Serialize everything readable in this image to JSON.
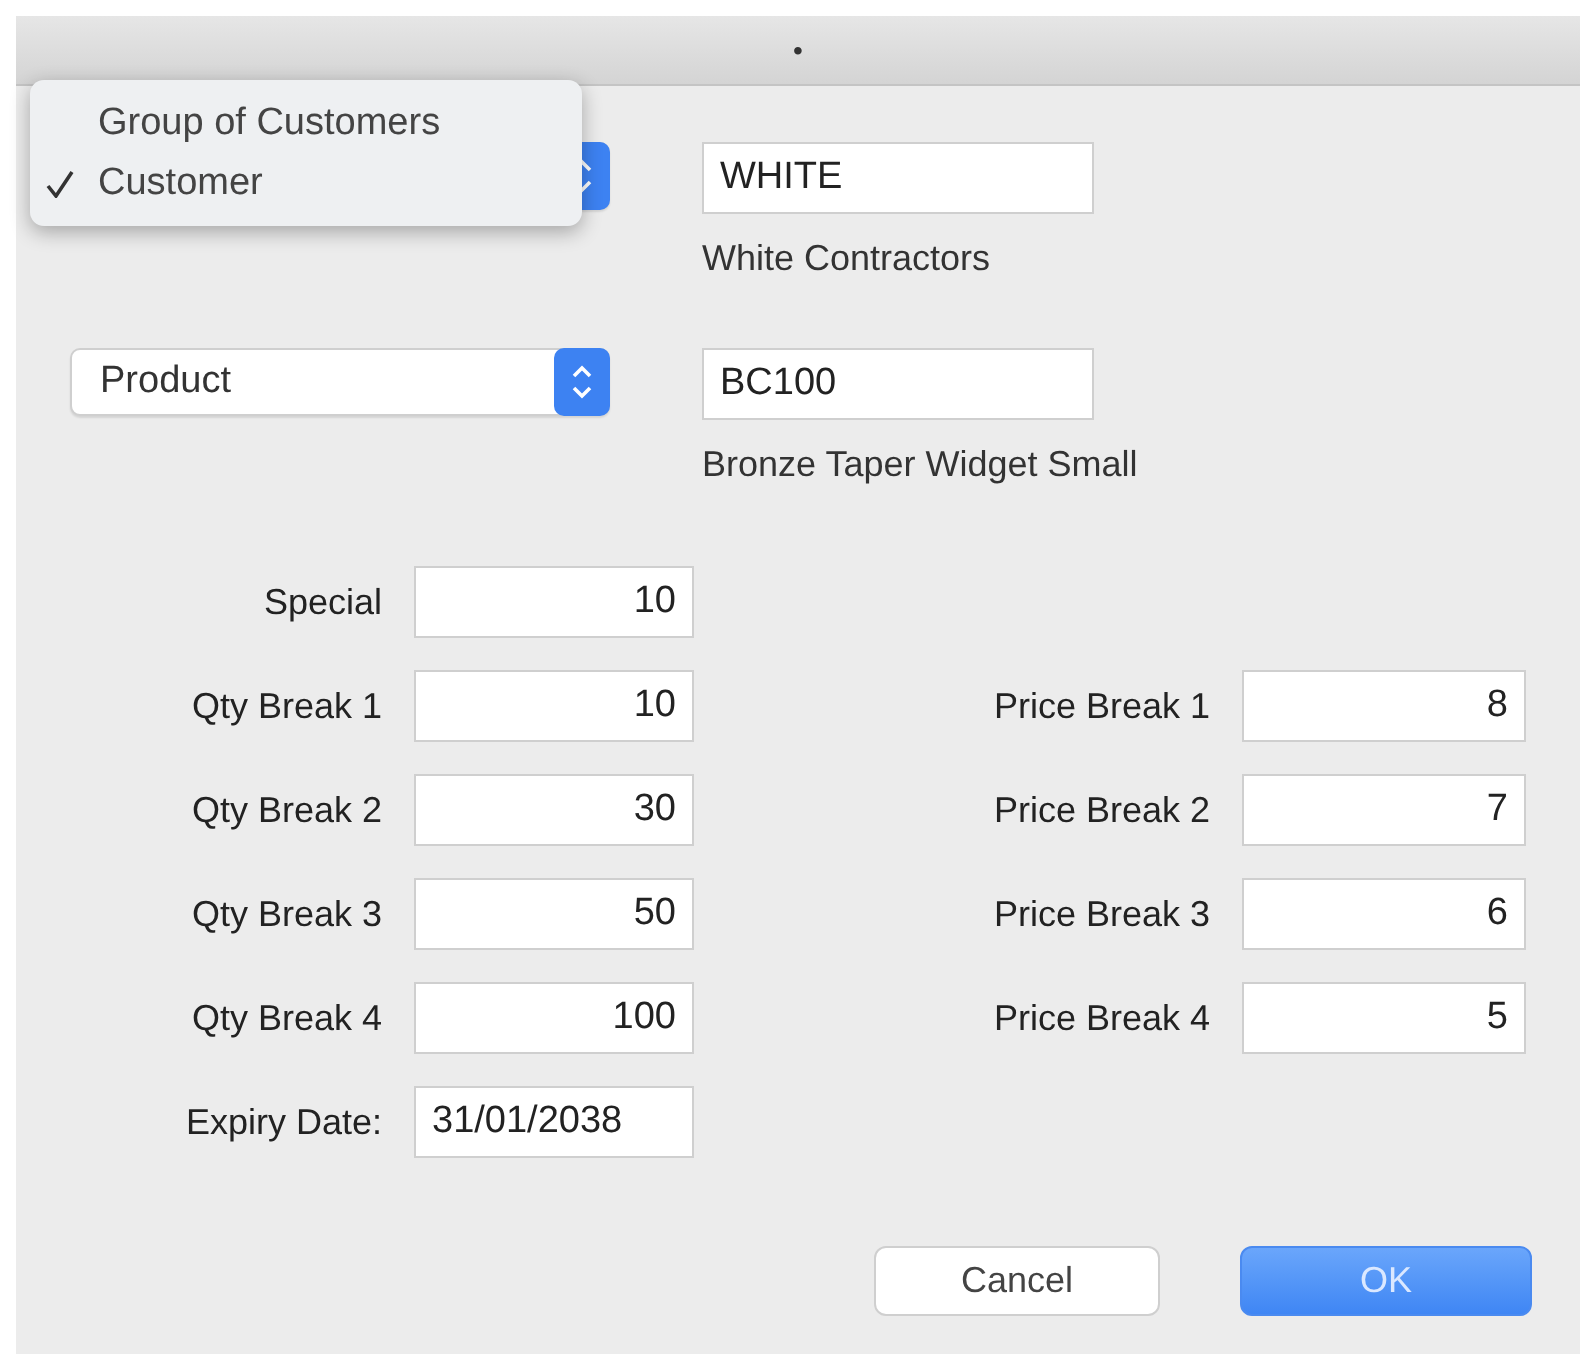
{
  "window": {
    "title": "•"
  },
  "menu": {
    "items": [
      {
        "label": "Group of Customers",
        "selected": false
      },
      {
        "label": "Customer",
        "selected": true
      }
    ]
  },
  "customer": {
    "code": "WHITE",
    "name": "White Contractors"
  },
  "product": {
    "popup": "Product",
    "code": "BC100",
    "name": "Bronze Taper Widget Small"
  },
  "special": {
    "label": "Special",
    "value": "10"
  },
  "breaks": [
    {
      "qty_label": "Qty Break 1",
      "qty": "10",
      "price_label": "Price Break 1",
      "price": "8"
    },
    {
      "qty_label": "Qty Break 2",
      "qty": "30",
      "price_label": "Price Break 2",
      "price": "7"
    },
    {
      "qty_label": "Qty Break 3",
      "qty": "50",
      "price_label": "Price Break 3",
      "price": "6"
    },
    {
      "qty_label": "Qty Break 4",
      "qty": "100",
      "price_label": "Price Break 4",
      "price": "5"
    }
  ],
  "expiry": {
    "label": "Expiry Date:",
    "value": "31/01/2038"
  },
  "buttons": {
    "cancel": "Cancel",
    "ok": "OK"
  }
}
